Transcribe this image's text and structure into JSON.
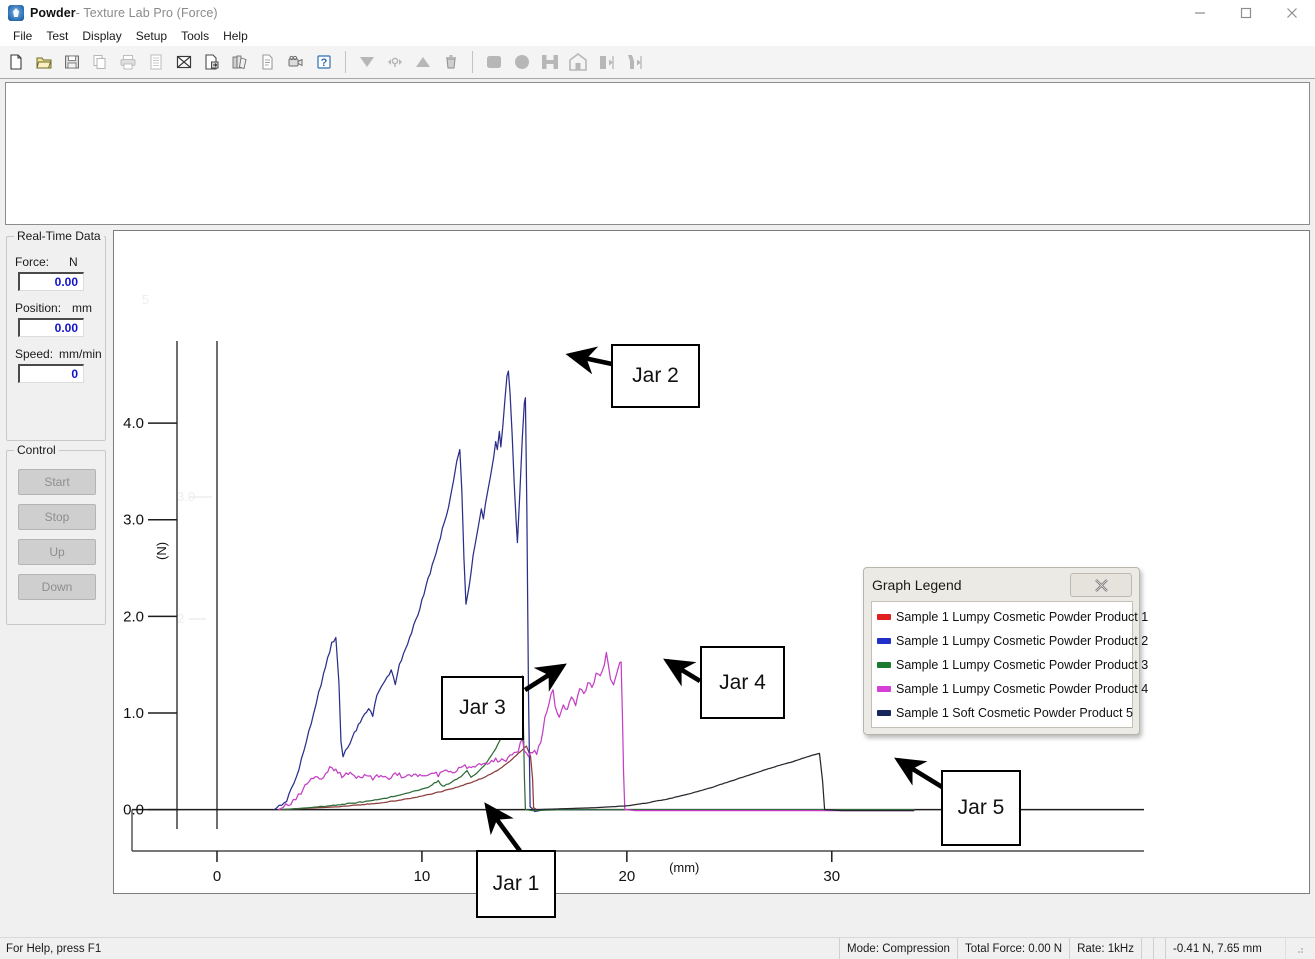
{
  "window": {
    "app_name": "Powder",
    "title_suffix": "- Texture Lab Pro (Force)",
    "minimize_icon": "minimize-icon",
    "maximize_icon": "maximize-icon",
    "close_icon": "close-icon"
  },
  "menu": {
    "items": [
      {
        "label": "File"
      },
      {
        "label": "Test"
      },
      {
        "label": "Display"
      },
      {
        "label": "Setup"
      },
      {
        "label": "Tools"
      },
      {
        "label": "Help"
      }
    ]
  },
  "toolbar": {
    "group1": [
      {
        "icon": "new-document-icon"
      },
      {
        "icon": "open-folder-icon"
      },
      {
        "icon": "save-disk-icon"
      },
      {
        "icon": "copy-icon"
      },
      {
        "icon": "print-icon"
      },
      {
        "icon": "print-preview-icon"
      },
      {
        "icon": "export-excel-icon"
      },
      {
        "icon": "export-document-icon"
      },
      {
        "icon": "library-icon"
      },
      {
        "icon": "report-icon"
      },
      {
        "icon": "camera-icon"
      },
      {
        "icon": "help-question-icon"
      }
    ],
    "group2": [
      {
        "icon": "triangle-down-icon"
      },
      {
        "icon": "calibrate-icon"
      },
      {
        "icon": "triangle-up-icon"
      },
      {
        "icon": "trash-icon"
      }
    ],
    "group3": [
      {
        "icon": "stop-square-icon"
      },
      {
        "icon": "circle-icon"
      },
      {
        "icon": "clamp-icon"
      },
      {
        "icon": "home-icon"
      },
      {
        "icon": "move-left-icon"
      },
      {
        "icon": "move-right-icon"
      }
    ]
  },
  "sidebar": {
    "realtime": {
      "group_title": "Real-Time Data",
      "fields": [
        {
          "label": "Force:",
          "unit": "N",
          "value": "0.00"
        },
        {
          "label": "Position:",
          "unit": "mm",
          "value": "0.00"
        },
        {
          "label": "Speed:",
          "unit": "mm/min",
          "value": "0"
        }
      ]
    },
    "control": {
      "group_title": "Control",
      "buttons": [
        {
          "label": "Start"
        },
        {
          "label": "Stop"
        },
        {
          "label": "Up"
        },
        {
          "label": "Down"
        }
      ]
    }
  },
  "legend_window": {
    "title": "Graph Legend",
    "close_icon": "close-icon",
    "entries": [
      {
        "label": "Sample 1 Lumpy Cosmetic Powder Product 1",
        "color": "#e02020"
      },
      {
        "label": "Sample 1 Lumpy Cosmetic Powder Product 2",
        "color": "#1f2fc8"
      },
      {
        "label": "Sample 1 Lumpy Cosmetic Powder Product 3",
        "color": "#1a7a2e"
      },
      {
        "label": "Sample 1 Lumpy Cosmetic Powder Product 4",
        "color": "#d63fd6"
      },
      {
        "label": "Sample 1 Soft Cosmetic Powder Product 5",
        "color": "#17275e"
      }
    ]
  },
  "annotations": [
    {
      "label": "Jar 1"
    },
    {
      "label": "Jar 2"
    },
    {
      "label": "Jar 3"
    },
    {
      "label": "Jar 4"
    },
    {
      "label": "Jar 5"
    }
  ],
  "statusbar": {
    "help_hint": "For Help, press F1",
    "mode": "Mode: Compression",
    "total_force": "Total Force: 0.00 N",
    "rate": "Rate: 1kHz",
    "cursor_readout": "-0.41 N, 7.65 mm"
  },
  "chart_data": {
    "type": "line",
    "title": "",
    "xlabel": "(mm)",
    "ylabel": "(N)",
    "xlim": [
      -2.0,
      34.5
    ],
    "ylim": [
      -0.18,
      4.85
    ],
    "xticks": [
      0,
      10,
      20,
      30
    ],
    "yticks": [
      0.0,
      1.0,
      2.0,
      3.0,
      4.0
    ],
    "ytick_labels": [
      "0.0",
      "1.0",
      "2.0",
      "3.0",
      "4.0"
    ],
    "grid": false,
    "legend_position": "floating-window-right",
    "ghost_yticks": [
      "2",
      "3.0"
    ],
    "series": [
      {
        "name": "Sample 1 Lumpy Cosmetic Powder Product 1",
        "color": "#8d3b3b",
        "annotation": "",
        "points": [
          [
            3.0,
            0.0
          ],
          [
            4.0,
            0.01
          ],
          [
            5.0,
            0.02
          ],
          [
            6.0,
            0.03
          ],
          [
            7.0,
            0.05
          ],
          [
            8.0,
            0.07
          ],
          [
            9.0,
            0.1
          ],
          [
            10.0,
            0.14
          ],
          [
            11.0,
            0.19
          ],
          [
            12.0,
            0.25
          ],
          [
            13.0,
            0.33
          ],
          [
            13.8,
            0.42
          ],
          [
            14.4,
            0.52
          ],
          [
            14.9,
            0.62
          ],
          [
            15.1,
            0.66
          ],
          [
            15.3,
            0.55
          ],
          [
            15.4,
            0.32
          ],
          [
            15.45,
            0.02
          ],
          [
            15.6,
            0.0
          ],
          [
            20.0,
            0.0
          ],
          [
            30.0,
            0.0
          ],
          [
            34.0,
            0.0
          ]
        ]
      },
      {
        "name": "Sample 1 Lumpy Cosmetic Powder Product 2",
        "color": "#2b2f8a",
        "annotation": "Jar 2",
        "peak_value": 4.55,
        "peak_at_mm": 14.2,
        "points": [
          [
            2.8,
            0.0
          ],
          [
            3.4,
            0.1
          ],
          [
            4.0,
            0.42
          ],
          [
            4.6,
            0.9
          ],
          [
            5.2,
            1.4
          ],
          [
            5.6,
            1.72
          ],
          [
            5.8,
            1.78
          ],
          [
            5.95,
            1.3
          ],
          [
            6.05,
            0.7
          ],
          [
            6.15,
            0.56
          ],
          [
            6.5,
            0.7
          ],
          [
            7.0,
            0.92
          ],
          [
            7.4,
            1.06
          ],
          [
            7.6,
            0.98
          ],
          [
            7.8,
            1.18
          ],
          [
            8.2,
            1.35
          ],
          [
            8.5,
            1.44
          ],
          [
            8.7,
            1.3
          ],
          [
            8.9,
            1.5
          ],
          [
            9.3,
            1.72
          ],
          [
            9.7,
            1.96
          ],
          [
            10.0,
            2.16
          ],
          [
            10.3,
            2.38
          ],
          [
            10.7,
            2.66
          ],
          [
            11.0,
            2.9
          ],
          [
            11.3,
            3.14
          ],
          [
            11.55,
            3.4
          ],
          [
            11.7,
            3.62
          ],
          [
            11.85,
            3.72
          ],
          [
            11.95,
            3.3
          ],
          [
            12.05,
            2.6
          ],
          [
            12.15,
            2.12
          ],
          [
            12.3,
            2.3
          ],
          [
            12.5,
            2.62
          ],
          [
            12.75,
            2.92
          ],
          [
            12.9,
            3.1
          ],
          [
            13.0,
            3.02
          ],
          [
            13.1,
            3.18
          ],
          [
            13.35,
            3.44
          ],
          [
            13.5,
            3.66
          ],
          [
            13.6,
            3.82
          ],
          [
            13.68,
            3.72
          ],
          [
            13.78,
            3.9
          ],
          [
            13.85,
            3.76
          ],
          [
            13.95,
            3.98
          ],
          [
            14.05,
            4.26
          ],
          [
            14.15,
            4.5
          ],
          [
            14.22,
            4.55
          ],
          [
            14.3,
            4.3
          ],
          [
            14.4,
            3.9
          ],
          [
            14.5,
            3.4
          ],
          [
            14.6,
            2.96
          ],
          [
            14.66,
            2.78
          ],
          [
            14.78,
            3.3
          ],
          [
            14.9,
            3.86
          ],
          [
            15.0,
            4.22
          ],
          [
            15.05,
            4.28
          ],
          [
            15.12,
            3.1
          ],
          [
            15.2,
            1.2
          ],
          [
            15.28,
            0.04
          ],
          [
            15.5,
            -0.02
          ],
          [
            16.0,
            0.0
          ],
          [
            20.0,
            0.0
          ],
          [
            30.0,
            0.0
          ],
          [
            34.0,
            0.0
          ]
        ]
      },
      {
        "name": "Sample 1 Lumpy Cosmetic Powder Product 3",
        "color": "#2f6b3a",
        "annotation": "Jar 3",
        "peak_value": 1.38,
        "peak_at_mm": 14.9,
        "points": [
          [
            3.2,
            0.0
          ],
          [
            4.5,
            0.02
          ],
          [
            6.0,
            0.05
          ],
          [
            7.5,
            0.09
          ],
          [
            8.5,
            0.13
          ],
          [
            9.5,
            0.18
          ],
          [
            10.3,
            0.23
          ],
          [
            10.8,
            0.3
          ],
          [
            11.0,
            0.24
          ],
          [
            11.4,
            0.28
          ],
          [
            11.9,
            0.34
          ],
          [
            12.2,
            0.4
          ],
          [
            12.4,
            0.33
          ],
          [
            12.8,
            0.4
          ],
          [
            13.2,
            0.5
          ],
          [
            13.6,
            0.63
          ],
          [
            14.0,
            0.8
          ],
          [
            14.35,
            0.98
          ],
          [
            14.6,
            1.14
          ],
          [
            14.8,
            1.3
          ],
          [
            14.9,
            1.38
          ],
          [
            14.95,
            0.9
          ],
          [
            15.0,
            0.35
          ],
          [
            15.05,
            0.0
          ],
          [
            15.4,
            -0.01
          ],
          [
            17.0,
            0.0
          ],
          [
            20.0,
            0.0
          ],
          [
            24.0,
            0.0
          ],
          [
            30.0,
            0.0
          ],
          [
            34.0,
            0.0
          ]
        ]
      },
      {
        "name": "Sample 1 Lumpy Cosmetic Powder Product 4",
        "color": "#c43fc4",
        "annotation": "Jar 4",
        "peak_value": 1.55,
        "peak_at_mm": 19.7,
        "points": [
          [
            3.0,
            0.0
          ],
          [
            3.6,
            0.06
          ],
          [
            4.1,
            0.18
          ],
          [
            4.5,
            0.31
          ],
          [
            4.8,
            0.36
          ],
          [
            5.0,
            0.3
          ],
          [
            5.2,
            0.33
          ],
          [
            5.5,
            0.42
          ],
          [
            5.8,
            0.4
          ],
          [
            6.1,
            0.35
          ],
          [
            6.4,
            0.38
          ],
          [
            6.8,
            0.33
          ],
          [
            7.2,
            0.36
          ],
          [
            7.6,
            0.32
          ],
          [
            8.0,
            0.36
          ],
          [
            8.4,
            0.33
          ],
          [
            8.8,
            0.37
          ],
          [
            9.2,
            0.33
          ],
          [
            9.6,
            0.38
          ],
          [
            10.0,
            0.34
          ],
          [
            10.4,
            0.39
          ],
          [
            10.8,
            0.36
          ],
          [
            11.2,
            0.42
          ],
          [
            11.6,
            0.38
          ],
          [
            12.0,
            0.45
          ],
          [
            12.4,
            0.41
          ],
          [
            12.8,
            0.48
          ],
          [
            13.2,
            0.45
          ],
          [
            13.6,
            0.52
          ],
          [
            14.0,
            0.5
          ],
          [
            14.4,
            0.58
          ],
          [
            14.7,
            0.62
          ],
          [
            14.9,
            0.72
          ],
          [
            15.0,
            0.62
          ],
          [
            15.2,
            0.55
          ],
          [
            15.4,
            0.6
          ],
          [
            15.6,
            0.58
          ],
          [
            15.8,
            0.7
          ],
          [
            16.0,
            0.95
          ],
          [
            16.2,
            1.12
          ],
          [
            16.4,
            1.22
          ],
          [
            16.5,
            1.05
          ],
          [
            16.7,
            0.98
          ],
          [
            16.9,
            1.1
          ],
          [
            17.1,
            1.02
          ],
          [
            17.3,
            1.18
          ],
          [
            17.5,
            1.1
          ],
          [
            17.7,
            1.26
          ],
          [
            17.9,
            1.18
          ],
          [
            18.1,
            1.32
          ],
          [
            18.3,
            1.26
          ],
          [
            18.5,
            1.4
          ],
          [
            18.7,
            1.36
          ],
          [
            18.9,
            1.5
          ],
          [
            19.0,
            1.62
          ],
          [
            19.1,
            1.52
          ],
          [
            19.2,
            1.36
          ],
          [
            19.35,
            1.3
          ],
          [
            19.5,
            1.42
          ],
          [
            19.65,
            1.54
          ],
          [
            19.72,
            1.55
          ],
          [
            19.78,
            1.0
          ],
          [
            19.84,
            0.4
          ],
          [
            19.9,
            0.0
          ],
          [
            20.4,
            -0.01
          ],
          [
            24.0,
            -0.01
          ],
          [
            30.0,
            -0.01
          ],
          [
            34.0,
            -0.01
          ]
        ]
      },
      {
        "name": "Sample 1 Soft Cosmetic Powder Product 5",
        "color": "#26282f",
        "annotation": "Jar 5",
        "peak_value": 0.58,
        "peak_at_mm": 29.4,
        "points": [
          [
            15.6,
            0.0
          ],
          [
            17.0,
            0.01
          ],
          [
            18.5,
            0.02
          ],
          [
            20.0,
            0.04
          ],
          [
            21.0,
            0.07
          ],
          [
            22.0,
            0.11
          ],
          [
            23.0,
            0.16
          ],
          [
            24.0,
            0.22
          ],
          [
            25.0,
            0.29
          ],
          [
            26.0,
            0.36
          ],
          [
            27.0,
            0.43
          ],
          [
            28.0,
            0.49
          ],
          [
            29.0,
            0.56
          ],
          [
            29.4,
            0.58
          ],
          [
            29.55,
            0.3
          ],
          [
            29.65,
            0.0
          ],
          [
            30.5,
            -0.01
          ],
          [
            34.0,
            -0.01
          ]
        ]
      }
    ]
  }
}
